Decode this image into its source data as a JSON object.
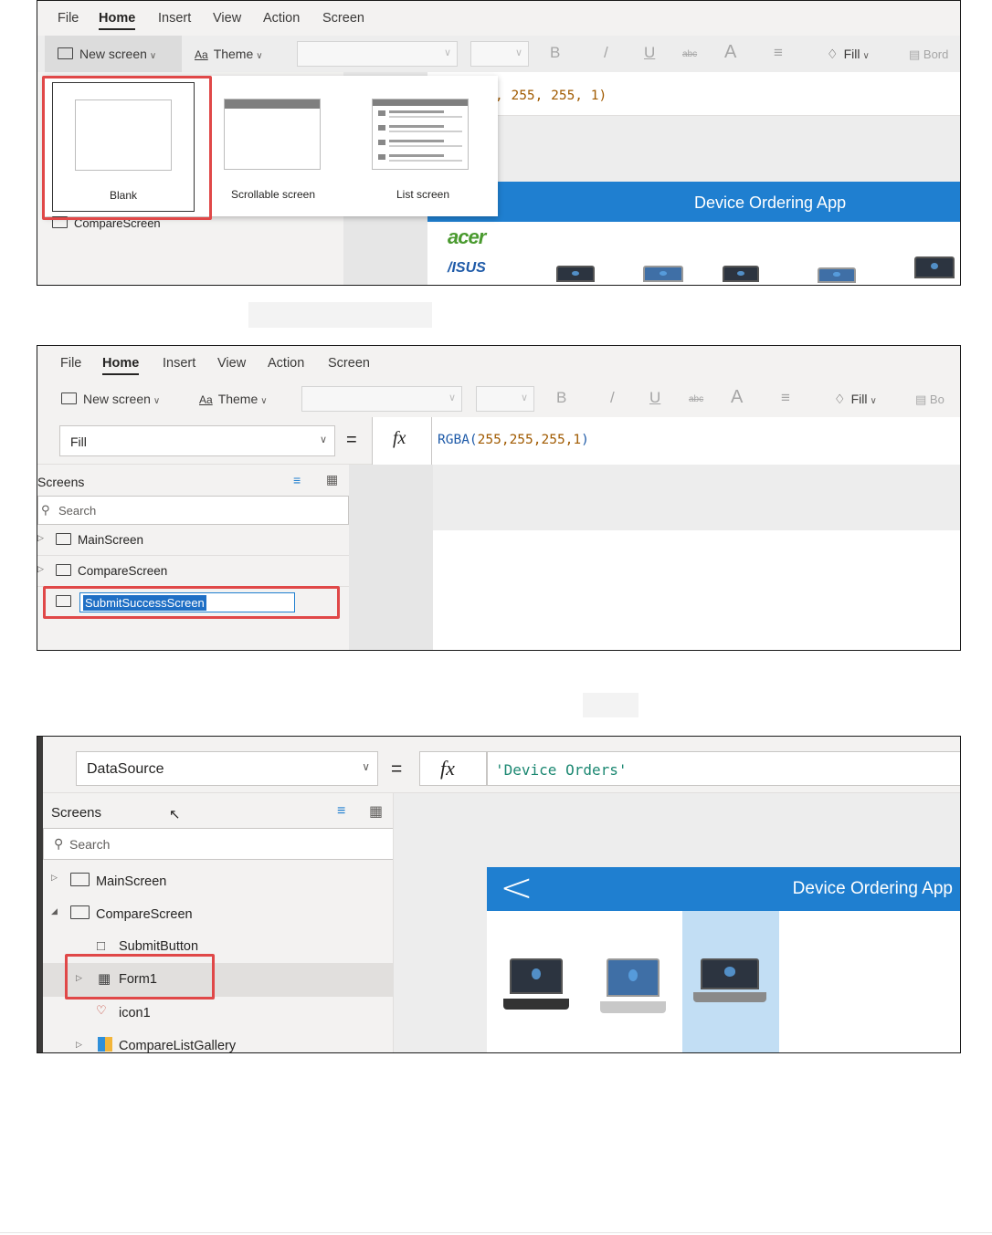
{
  "menu": [
    "File",
    "Home",
    "Insert",
    "View",
    "Action",
    "Screen"
  ],
  "toolbar": {
    "new_screen": "New screen",
    "theme": "Theme",
    "bold": "B",
    "italic": "/",
    "underline": "U",
    "strike": "abc",
    "font_size": "A",
    "fill": "Fill",
    "border_short_1": "Bord",
    "border_short_2": "Bo"
  },
  "panel1": {
    "formula_tail": ", 255, 255, 1)",
    "templates": [
      "Blank",
      "Scrollable screen",
      "List screen"
    ],
    "compare_screen": "CompareScreen",
    "app_title": "Device Ordering App",
    "brands": [
      "acer",
      "/ISUS"
    ]
  },
  "panel2": {
    "property": "Fill",
    "equals": "=",
    "fx": "fx",
    "formula_fn": "RGBA(",
    "formula_args": "255,255,255,1",
    "formula_close": ")",
    "screens_title": "Screens",
    "search_placeholder": "Search",
    "screens": [
      "MainScreen",
      "CompareScreen"
    ],
    "rename_value": "SubmitSuccessScreen"
  },
  "panel3": {
    "property": "DataSource",
    "equals": "=",
    "fx": "fx",
    "formula": "'Device Orders'",
    "screens_title": "Screens",
    "search_placeholder": "Search",
    "tree": [
      "MainScreen",
      "CompareScreen",
      "SubmitButton",
      "Form1",
      "icon1",
      "CompareListGallery"
    ],
    "app_title": "Device Ordering App",
    "back": "<"
  },
  "colors": {
    "accent_blue": "#1f7fd0",
    "highlight_red": "#e04848",
    "selection_blue": "#c2def4"
  }
}
